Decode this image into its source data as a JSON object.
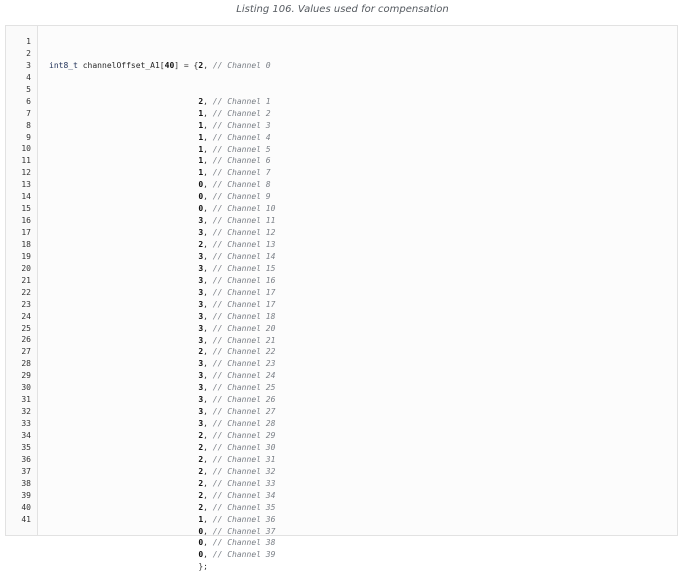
{
  "caption": "Listing 106. Values used for compensation",
  "declaration": {
    "type": "int8_t",
    "name": "channelOffset_A1",
    "size": "40",
    "opening": " = {"
  },
  "entries": [
    {
      "value": "2",
      "comment": "// Channel 0"
    },
    {
      "value": "2",
      "comment": "// Channel 1"
    },
    {
      "value": "1",
      "comment": "// Channel 2"
    },
    {
      "value": "1",
      "comment": "// Channel 3"
    },
    {
      "value": "1",
      "comment": "// Channel 4"
    },
    {
      "value": "1",
      "comment": "// Channel 5"
    },
    {
      "value": "1",
      "comment": "// Channel 6"
    },
    {
      "value": "1",
      "comment": "// Channel 7"
    },
    {
      "value": "0",
      "comment": "// Channel 8"
    },
    {
      "value": "0",
      "comment": "// Channel 9"
    },
    {
      "value": "0",
      "comment": "// Channel 10"
    },
    {
      "value": "3",
      "comment": "// Channel 11"
    },
    {
      "value": "3",
      "comment": "// Channel 12"
    },
    {
      "value": "2",
      "comment": "// Channel 13"
    },
    {
      "value": "3",
      "comment": "// Channel 14"
    },
    {
      "value": "3",
      "comment": "// Channel 15"
    },
    {
      "value": "3",
      "comment": "// Channel 16"
    },
    {
      "value": "3",
      "comment": "// Channel 17"
    },
    {
      "value": "3",
      "comment": "// Channel 17"
    },
    {
      "value": "3",
      "comment": "// Channel 18"
    },
    {
      "value": "3",
      "comment": "// Channel 20"
    },
    {
      "value": "3",
      "comment": "// Channel 21"
    },
    {
      "value": "2",
      "comment": "// Channel 22"
    },
    {
      "value": "3",
      "comment": "// Channel 23"
    },
    {
      "value": "3",
      "comment": "// Channel 24"
    },
    {
      "value": "3",
      "comment": "// Channel 25"
    },
    {
      "value": "3",
      "comment": "// Channel 26"
    },
    {
      "value": "3",
      "comment": "// Channel 27"
    },
    {
      "value": "3",
      "comment": "// Channel 28"
    },
    {
      "value": "2",
      "comment": "// Channel 29"
    },
    {
      "value": "2",
      "comment": "// Channel 30"
    },
    {
      "value": "2",
      "comment": "// Channel 31"
    },
    {
      "value": "2",
      "comment": "// Channel 32"
    },
    {
      "value": "2",
      "comment": "// Channel 33"
    },
    {
      "value": "2",
      "comment": "// Channel 34"
    },
    {
      "value": "2",
      "comment": "// Channel 35"
    },
    {
      "value": "1",
      "comment": "// Channel 36"
    },
    {
      "value": "0",
      "comment": "// Channel 37"
    },
    {
      "value": "0",
      "comment": "// Channel 38"
    },
    {
      "value": "0",
      "comment": "// Channel 39"
    }
  ],
  "closing": "};",
  "line_numbers": [
    "1",
    "2",
    "3",
    "4",
    "5",
    "6",
    "7",
    "8",
    "9",
    "10",
    "11",
    "12",
    "13",
    "14",
    "15",
    "16",
    "17",
    "18",
    "19",
    "20",
    "21",
    "22",
    "23",
    "24",
    "25",
    "26",
    "27",
    "28",
    "29",
    "30",
    "31",
    "32",
    "33",
    "34",
    "35",
    "36",
    "37",
    "38",
    "39",
    "40",
    "41"
  ],
  "colors": {
    "border": "#e2e2e2",
    "background": "#fcfcfc",
    "comment": "#7a7f86",
    "type_keyword": "#22335a"
  }
}
